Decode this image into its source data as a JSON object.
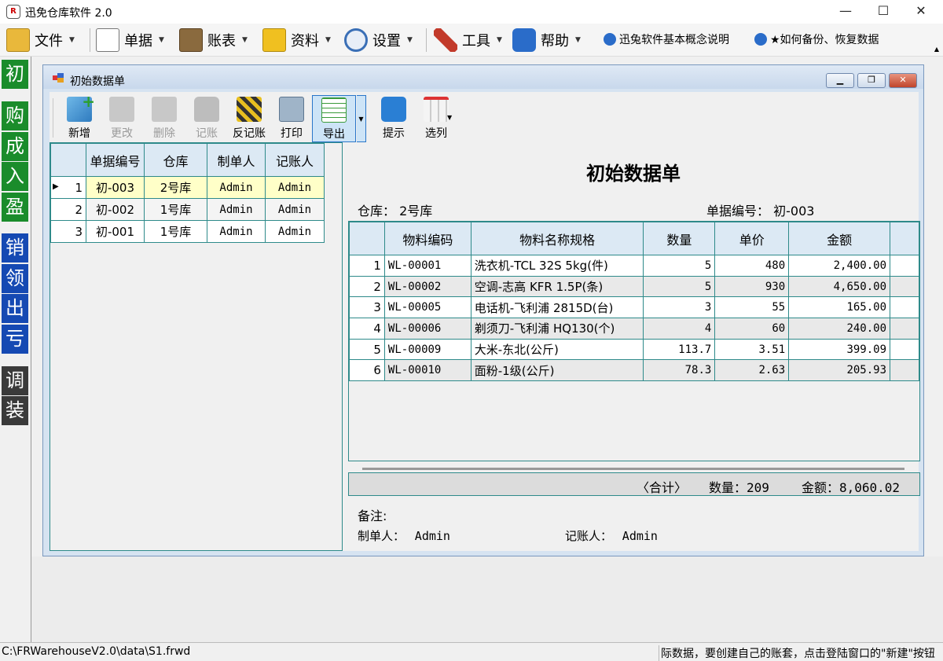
{
  "app": {
    "title": "迅免仓库软件 2.0",
    "icon_text": "R"
  },
  "window_controls": {
    "minimize": "—",
    "maximize": "☐",
    "close": "✕"
  },
  "menubar": {
    "items": [
      {
        "label": "文件",
        "icon": "folder-icon"
      },
      {
        "label": "单据",
        "icon": "document-icon"
      },
      {
        "label": "账表",
        "icon": "ledger-icon"
      },
      {
        "label": "资料",
        "icon": "files-icon"
      },
      {
        "label": "设置",
        "icon": "gear-icon"
      },
      {
        "label": "工具",
        "icon": "tools-icon"
      },
      {
        "label": "帮助",
        "icon": "help-icon"
      }
    ],
    "links": [
      {
        "label": "迅兔软件基本概念说明"
      },
      {
        "label": "★如何备份、恢复数据"
      }
    ]
  },
  "leftnav": [
    {
      "label": "初",
      "color": "#1a8c2b"
    },
    {
      "label": "购",
      "color": "#1a8c2b"
    },
    {
      "label": "成",
      "color": "#1a8c2b"
    },
    {
      "label": "入",
      "color": "#1a8c2b"
    },
    {
      "label": "盈",
      "color": "#1a8c2b"
    },
    {
      "label": "销",
      "color": "#1549b3"
    },
    {
      "label": "领",
      "color": "#1549b3"
    },
    {
      "label": "出",
      "color": "#1549b3"
    },
    {
      "label": "亏",
      "color": "#1549b3"
    },
    {
      "label": "调",
      "color": "#3a3a3a"
    },
    {
      "label": "装",
      "color": "#3a3a3a"
    }
  ],
  "child_window": {
    "title": "初始数据单",
    "toolbar": [
      {
        "label": "新增",
        "enabled": true
      },
      {
        "label": "更改",
        "enabled": false
      },
      {
        "label": "删除",
        "enabled": false
      },
      {
        "label": "记账",
        "enabled": false
      },
      {
        "label": "反记账",
        "enabled": true
      },
      {
        "label": "打印",
        "enabled": true
      },
      {
        "label": "导出",
        "enabled": true
      },
      {
        "label": "提示",
        "enabled": true
      },
      {
        "label": "选列",
        "enabled": true
      }
    ]
  },
  "list_grid": {
    "headers": [
      "单据编号",
      "仓库",
      "制单人",
      "记账人"
    ],
    "rows": [
      {
        "num": "1",
        "doc_no": "初-003",
        "warehouse": "2号库",
        "maker": "Admin",
        "poster": "Admin"
      },
      {
        "num": "2",
        "doc_no": "初-002",
        "warehouse": "1号库",
        "maker": "Admin",
        "poster": "Admin"
      },
      {
        "num": "3",
        "doc_no": "初-001",
        "warehouse": "1号库",
        "maker": "Admin",
        "poster": "Admin"
      }
    ],
    "current_row_marker": "▶"
  },
  "document": {
    "title": "初始数据单",
    "warehouse_label": "仓库：",
    "warehouse_value": "2号库",
    "doc_no_label": "单据编号：",
    "doc_no_value": "初-003",
    "detail_headers": [
      "物料编码",
      "物料名称规格",
      "数量",
      "单价",
      "金额"
    ],
    "detail_rows": [
      {
        "num": "1",
        "code": "WL-00001",
        "name": "洗衣机-TCL 32S 5kg(件)",
        "qty": "5",
        "price": "480",
        "amount": "2,400.00"
      },
      {
        "num": "2",
        "code": "WL-00002",
        "name": "空调-志高 KFR 1.5P(条)",
        "qty": "5",
        "price": "930",
        "amount": "4,650.00"
      },
      {
        "num": "3",
        "code": "WL-00005",
        "name": "电话机-飞利浦 2815D(台)",
        "qty": "3",
        "price": "55",
        "amount": "165.00"
      },
      {
        "num": "4",
        "code": "WL-00006",
        "name": "剃须刀-飞利浦 HQ130(个)",
        "qty": "4",
        "price": "60",
        "amount": "240.00"
      },
      {
        "num": "5",
        "code": "WL-00009",
        "name": "大米-东北(公斤)",
        "qty": "113.7",
        "price": "3.51",
        "amount": "399.09"
      },
      {
        "num": "6",
        "code": "WL-00010",
        "name": "面粉-1级(公斤)",
        "qty": "78.3",
        "price": "2.63",
        "amount": "205.93"
      }
    ],
    "total_label": "〈合计〉",
    "total_qty": "数量：209",
    "total_amount": "金额：8,060.02",
    "note_label": "备注:",
    "maker_label": "制单人：",
    "maker_value": "Admin",
    "poster_label": "记账人：",
    "poster_value": "Admin"
  },
  "statusbar": {
    "path": "C:\\FRWarehouseV2.0\\data\\S1.frwd",
    "hint": "际数据，要创建自己的账套，点击登陆窗口的\"新建\"按钮"
  }
}
